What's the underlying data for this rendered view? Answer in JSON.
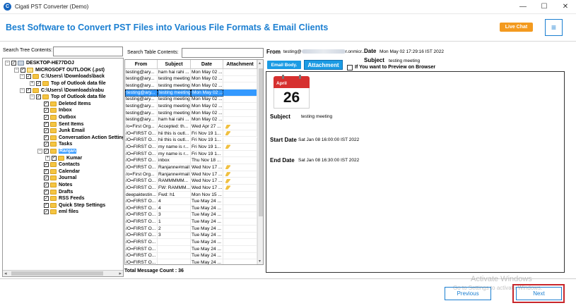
{
  "window": {
    "title": "Cigati PST Converter (Demo)",
    "icon_letter": "C",
    "minimize": "—",
    "maximize": "☐",
    "close": "✕"
  },
  "header": {
    "title": "Best Software to Convert PST Files into Various File Formats & Email Clients",
    "live_chat": "Live Chat",
    "menu_icon": "≡"
  },
  "tree": {
    "search_label": "Search Tree Contents:",
    "search_value": "",
    "items": [
      {
        "label": "DESKTOP-HE77DOJ",
        "exp": "−",
        "icon": "drive",
        "level": 0
      },
      {
        "label": "MICROSOFT OUTLOOK (.pst)",
        "exp": "−",
        "icon": "pst",
        "level": 1
      },
      {
        "label": "C:\\Users\\        \\Downloads\\back",
        "exp": "−",
        "icon": "folder",
        "level": 2
      },
      {
        "label": "Top of Outlook data file",
        "exp": "+",
        "icon": "folder",
        "level": 3
      },
      {
        "label": "C:\\Users\\        \\Downloads\\rabu",
        "exp": "−",
        "icon": "folder",
        "level": 2
      },
      {
        "label": "Top of Outlook data file",
        "exp": "−",
        "icon": "folder",
        "level": 3
      },
      {
        "label": "Deleted Items",
        "exp": "",
        "icon": "folder",
        "level": 4
      },
      {
        "label": "Inbox",
        "exp": "",
        "icon": "folder",
        "level": 4
      },
      {
        "label": "Outbox",
        "exp": "",
        "icon": "folder",
        "level": 4
      },
      {
        "label": "Sent Items",
        "exp": "",
        "icon": "folder",
        "level": 4
      },
      {
        "label": "Junk Email",
        "exp": "",
        "icon": "folder",
        "level": 4
      },
      {
        "label": "Conversation Action Setting",
        "exp": "",
        "icon": "folder",
        "level": 4
      },
      {
        "label": "Tasks",
        "exp": "",
        "icon": "folder",
        "level": 4
      },
      {
        "label": "Ranjan",
        "exp": "−",
        "icon": "folder",
        "level": 4,
        "selected": true
      },
      {
        "label": "Kumar",
        "exp": "+",
        "icon": "folder",
        "level": 5
      },
      {
        "label": "Contacts",
        "exp": "",
        "icon": "folder",
        "level": 4
      },
      {
        "label": "Calendar",
        "exp": "",
        "icon": "folder",
        "level": 4
      },
      {
        "label": "Journal",
        "exp": "",
        "icon": "folder",
        "level": 4
      },
      {
        "label": "Notes",
        "exp": "",
        "icon": "folder",
        "level": 4
      },
      {
        "label": "Drafts",
        "exp": "",
        "icon": "folder",
        "level": 4
      },
      {
        "label": "RSS Feeds",
        "exp": "",
        "icon": "folder",
        "level": 4
      },
      {
        "label": "Quick Step Settings",
        "exp": "",
        "icon": "folder",
        "level": 4
      },
      {
        "label": "eml files",
        "exp": "",
        "icon": "folder",
        "level": 4
      }
    ]
  },
  "table": {
    "search_label": "Search Table Contents:",
    "search_value": "",
    "columns": [
      "From",
      "Subject",
      "Date",
      "Attachment"
    ],
    "rows": [
      {
        "from": "testing@ary...",
        "subject": "ham hai rahi ...",
        "date": "Mon May 02 ...",
        "att": false
      },
      {
        "from": "testing@ary...",
        "subject": "testing meeting",
        "date": "Mon May 02 ...",
        "att": false
      },
      {
        "from": "testing@ary...",
        "subject": "testing meeting",
        "date": "Mon May 02 ...",
        "att": false
      },
      {
        "from": "testing@ary...",
        "subject": "testing meeting",
        "date": "Mon May 02 ...",
        "att": false,
        "selected": true
      },
      {
        "from": "testing@ary...",
        "subject": "testing meeting",
        "date": "Mon May 02 ...",
        "att": false
      },
      {
        "from": "testing@ary...",
        "subject": "testing meeting",
        "date": "Mon May 02 ...",
        "att": false
      },
      {
        "from": "testing@ary...",
        "subject": "testing meeting",
        "date": "Mon May 02 ...",
        "att": false
      },
      {
        "from": "testing@ary...",
        "subject": "ham hai rahi ...",
        "date": "Mon May 02 ...",
        "att": false
      },
      {
        "from": "/o=First Org...",
        "subject": "Accepted: th...",
        "date": "Wed Apr 27 ...",
        "att": true
      },
      {
        "from": "/O=FIRST O...",
        "subject": "hii this is outl...",
        "date": "Fri Nov 19 1...",
        "att": true
      },
      {
        "from": "/O=FIRST O...",
        "subject": "hii this is outl...",
        "date": "Fri Nov 19 1...",
        "att": false
      },
      {
        "from": "/O=FIRST O...",
        "subject": "my name is r...",
        "date": "Fri Nov 19 1...",
        "att": true
      },
      {
        "from": "/O=FIRST O...",
        "subject": "my name is r...",
        "date": "Fri Nov 19 1...",
        "att": false
      },
      {
        "from": "/O=FIRST O...",
        "subject": "inbox",
        "date": "Thu Nov 18 ...",
        "att": false
      },
      {
        "from": "/O=FIRST O...",
        "subject": "Ranjanne#mail",
        "date": "Wed Nov 17 ...",
        "att": true
      },
      {
        "from": "/o=First Org...",
        "subject": "Ranjanne#mail",
        "date": "Wed Nov 17 ...",
        "att": true
      },
      {
        "from": "/O=FIRST O...",
        "subject": "RAMMMMM...",
        "date": "Wed Nov 17 ...",
        "att": true
      },
      {
        "from": "/O=FIRST O...",
        "subject": "FW: RAMMM...",
        "date": "Wed Nov 17 ...",
        "att": true
      },
      {
        "from": "deepaktestin...",
        "subject": "Fwd: h1",
        "date": "Mon Nov 15 ...",
        "att": false
      },
      {
        "from": "/O=FIRST O...",
        "subject": "4",
        "date": "Tue May 24 ...",
        "att": false
      },
      {
        "from": "/O=FIRST O...",
        "subject": "4",
        "date": "Tue May 24 ...",
        "att": false
      },
      {
        "from": "/O=FIRST O...",
        "subject": "3",
        "date": "Tue May 24 ...",
        "att": false
      },
      {
        "from": "/O=FIRST O...",
        "subject": "1",
        "date": "Tue May 24 ...",
        "att": false
      },
      {
        "from": "/O=FIRST O...",
        "subject": "2",
        "date": "Tue May 24 ...",
        "att": false
      },
      {
        "from": "/O=FIRST O...",
        "subject": "3",
        "date": "Tue May 24 ...",
        "att": false
      },
      {
        "from": "/O=FIRST O...",
        "subject": "",
        "date": "Tue May 24 ...",
        "att": false
      },
      {
        "from": "/O=FIRST O...",
        "subject": "",
        "date": "Tue May 24 ...",
        "att": false
      },
      {
        "from": "/O=FIRST O...",
        "subject": "",
        "date": "Tue May 24 ...",
        "att": false
      },
      {
        "from": "/O=FIRST O...",
        "subject": "",
        "date": "Tue May 24 ...",
        "att": false
      }
    ],
    "total_count": "Total Message Count : 36"
  },
  "preview": {
    "from_label": "From",
    "from_prefix": "testing@",
    "from_suffix": "r.onmicr...",
    "date_label": "Date",
    "date_value": "Mon May 02 17:29:16 IST 2022",
    "subject_label": "Subject",
    "subject_value": "testing meeting",
    "email_body_button": "Email Body.",
    "attachment_button": "Attachment",
    "preview_checkbox_label": "If You want to Preview on Browser",
    "calendar_month": "April",
    "calendar_day": "26",
    "rows": [
      {
        "label": "Subject",
        "value": "testing meeting"
      },
      {
        "label": "Start Date",
        "value": "Sat Jan 08 16:00:00 IST 2022"
      },
      {
        "label": "End Date",
        "value": "Sat Jan 08 16:30:00 IST 2022"
      }
    ]
  },
  "footer": {
    "previous": "Previous",
    "next": "Next",
    "watermark_line1": "Activate Windows",
    "watermark_line2": "Go to Settings to activate Windows."
  },
  "colors": {
    "brand_blue": "#1b7fd1",
    "live_chat_orange": "#f39a1f",
    "button_blue": "#1b9be4",
    "highlight_red": "#c8262b",
    "selection_blue": "#3399ff",
    "calendar_red": "#d6302f"
  }
}
